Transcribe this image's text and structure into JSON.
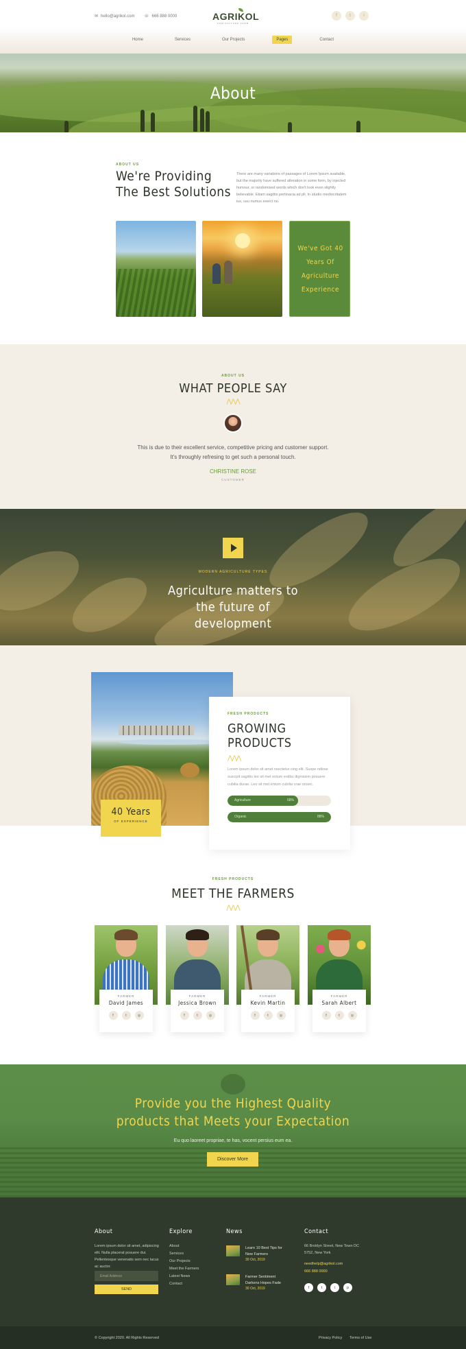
{
  "header": {
    "email": "hello@agrikol.com",
    "phone": "666 888 0000",
    "logo_text": "AGRIKOL",
    "logo_tagline": "AGRICULTURE FARM",
    "socials": [
      "f",
      "t",
      "i"
    ],
    "nav": [
      "Home",
      "Services",
      "Our Projects",
      "Pages",
      "Contact"
    ],
    "active_nav": "Pages"
  },
  "hero": {
    "title": "About"
  },
  "about": {
    "label": "ABOUT US",
    "title": "We're Providing The Best Solutions",
    "text": "There are many variations of passages of Lorem Ipsum available, but the majority have suffered alteration in some form, by injected humour, or randomised words which don't look even slightly believable. Etiam sagittis pertinacia ad pli. In studio mediocritatem ius, usu numus exerci no.",
    "experience": "We've Got 40 Years Of Agriculture Experience"
  },
  "testimonial": {
    "label": "ABOUT US",
    "title": "WHAT PEOPLE SAY",
    "quote": "This is due to their excellent service, competitive pricing and customer support. It's throughly refresing to get such a personal touch.",
    "author": "CHRISTINE ROSE",
    "role": "CUSTOMER"
  },
  "video": {
    "label": "MODERN AGRICULTURE TYPES",
    "title": "Agriculture matters to the future of development"
  },
  "products": {
    "badge_number": "40 Years",
    "badge_sub": "OF EXPERIENCE",
    "label": "FRESH PRODUCTS",
    "title": "GROWING PRODUCTS",
    "text": "Lorem ipsum dolor sit amet nsectetur cing elit. Suspe ndisse suscipit sagittis leo sit met entum estibu dignissim posuere cubilia durae. Leo sit met entum cubilia crae onsec.",
    "bars": [
      {
        "label": "Agriculture",
        "value": "68%",
        "percent": 68
      },
      {
        "label": "Organic",
        "value": "88%",
        "percent": 100
      }
    ]
  },
  "farmers": {
    "label": "FRESH PRODUCTS",
    "title": "MEET THE FARMERS",
    "role": "FARMER",
    "list": [
      {
        "name": "David James"
      },
      {
        "name": "Jessica Brown"
      },
      {
        "name": "Kevin Martin"
      },
      {
        "name": "Sarah Albert"
      }
    ]
  },
  "cta": {
    "title": "Provide you the Highest Quality products that Meets your Expectation",
    "text": "Eu quo laoreet propriae, te has, vocent persius eum ea.",
    "button": "Discover More"
  },
  "footer": {
    "about_title": "About",
    "about_text": "Lorem ipsum dolor sit amet, adipiscing elit. Nulla placerat posuere dui. Pellentesque venenatis sem nec lacus ac auctor.",
    "email_placeholder": "Email Address",
    "send": "SEND",
    "explore_title": "Explore",
    "explore_links": [
      "About",
      "Services",
      "Our Projects",
      "Meet the Farmers",
      "Latest News",
      "Contact"
    ],
    "news_title": "News",
    "news": [
      {
        "title": "Learn 10 Best Tips for New Farmers",
        "date": "30 Oct, 2019"
      },
      {
        "title": "Farmer Sentiment Darkens Hopes Fade",
        "date": "30 Oct, 2019"
      }
    ],
    "contact_title": "Contact",
    "address": "66 Broklyn Street, New Town DC 5752, New York",
    "email": "needhelp@agrikol.com",
    "phone": "666 888 0000",
    "socials": [
      "f",
      "t",
      "i",
      "p"
    ],
    "copyright": "© Copyright 2020. All Rights Reserved",
    "privacy": "Privacy Policy",
    "terms": "Terms of Use"
  }
}
